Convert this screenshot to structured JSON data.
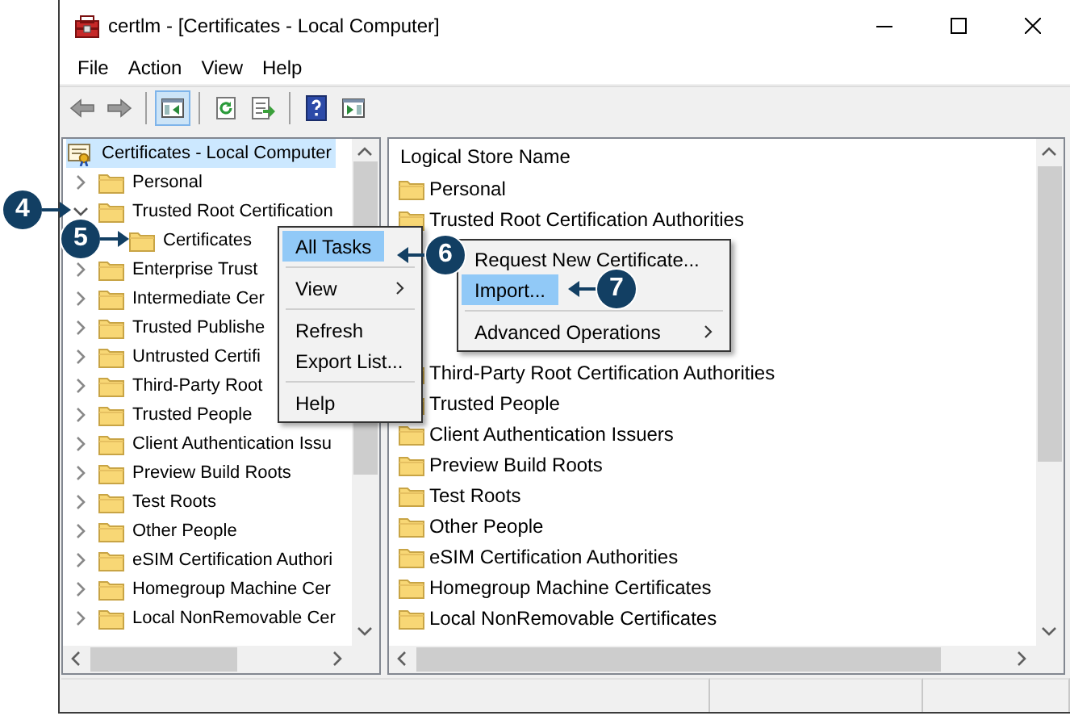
{
  "window": {
    "title": "certlm - [Certificates - Local Computer]"
  },
  "menu_bar": [
    "File",
    "Action",
    "View",
    "Help"
  ],
  "toolbar": [
    {
      "kind": "back",
      "pressed": false
    },
    {
      "kind": "forward",
      "pressed": false
    },
    {
      "kind": "separator"
    },
    {
      "kind": "tree-toggle",
      "pressed": true
    },
    {
      "kind": "separator"
    },
    {
      "kind": "refresh",
      "pressed": false
    },
    {
      "kind": "export",
      "pressed": false
    },
    {
      "kind": "separator"
    },
    {
      "kind": "help",
      "pressed": false
    },
    {
      "kind": "action-pane",
      "pressed": false
    }
  ],
  "tree": {
    "items": [
      {
        "label": "Certificates - Local Computer",
        "selected": true,
        "children": [
          {
            "label": "Personal",
            "expanded": false,
            "selected": false
          },
          {
            "label": "Trusted Root Certification",
            "expanded": true,
            "selected": false,
            "children": [
              {
                "label": "Certificates",
                "selected": false
              }
            ]
          },
          {
            "label": "Enterprise Trust",
            "expanded": false,
            "selected": false
          },
          {
            "label": "Intermediate Cer",
            "expanded": false,
            "selected": false
          },
          {
            "label": "Trusted Publishe",
            "expanded": false,
            "selected": false
          },
          {
            "label": "Untrusted Certifi",
            "expanded": false,
            "selected": false
          },
          {
            "label": "Third-Party Root",
            "expanded": false,
            "selected": false
          },
          {
            "label": "Trusted People",
            "expanded": false,
            "selected": false
          },
          {
            "label": "Client Authentication Issu",
            "expanded": false,
            "selected": false
          },
          {
            "label": "Preview Build Roots",
            "expanded": false,
            "selected": false
          },
          {
            "label": "Test Roots",
            "expanded": false,
            "selected": false
          },
          {
            "label": "Other People",
            "expanded": false,
            "selected": false
          },
          {
            "label": "eSIM Certification Authori",
            "expanded": false,
            "selected": false
          },
          {
            "label": "Homegroup Machine Cer",
            "expanded": false,
            "selected": false
          },
          {
            "label": "Local NonRemovable Cer",
            "expanded": false,
            "selected": false
          }
        ]
      }
    ]
  },
  "list": {
    "column": "Logical Store Name",
    "rows": [
      {
        "name": "Personal"
      },
      {
        "name": "Trusted Root Certification Authorities"
      },
      {
        "name": "Third-Party Root Certification Authorities"
      },
      {
        "name": "Trusted People"
      },
      {
        "name": "Client Authentication Issuers"
      },
      {
        "name": "Preview Build Roots"
      },
      {
        "name": "Test Roots"
      },
      {
        "name": "Other People"
      },
      {
        "name": "eSIM Certification Authorities"
      },
      {
        "name": "Homegroup Machine Certificates"
      },
      {
        "name": "Local NonRemovable Certificates"
      }
    ]
  },
  "context_menu": {
    "items": [
      {
        "kind": "item",
        "label": "All Tasks",
        "selected": true,
        "submenu": false
      },
      {
        "kind": "separator"
      },
      {
        "kind": "item",
        "label": "View",
        "selected": false,
        "submenu": true
      },
      {
        "kind": "separator"
      },
      {
        "kind": "item",
        "label": "Refresh",
        "selected": false,
        "submenu": false
      },
      {
        "kind": "item",
        "label": "Export List...",
        "selected": false,
        "submenu": false
      },
      {
        "kind": "separator"
      },
      {
        "kind": "item",
        "label": "Help",
        "selected": false,
        "submenu": false
      }
    ]
  },
  "submenu": {
    "items": [
      {
        "kind": "item",
        "label": "Request New Certificate...",
        "selected": false,
        "submenu": false
      },
      {
        "kind": "item",
        "label": "Import...",
        "selected": true,
        "submenu": false
      },
      {
        "kind": "separator"
      },
      {
        "kind": "item",
        "label": "Advanced Operations",
        "selected": false,
        "submenu": true
      }
    ]
  },
  "callouts": [
    {
      "number": "4"
    },
    {
      "number": "5"
    },
    {
      "number": "6"
    },
    {
      "number": "7"
    }
  ]
}
